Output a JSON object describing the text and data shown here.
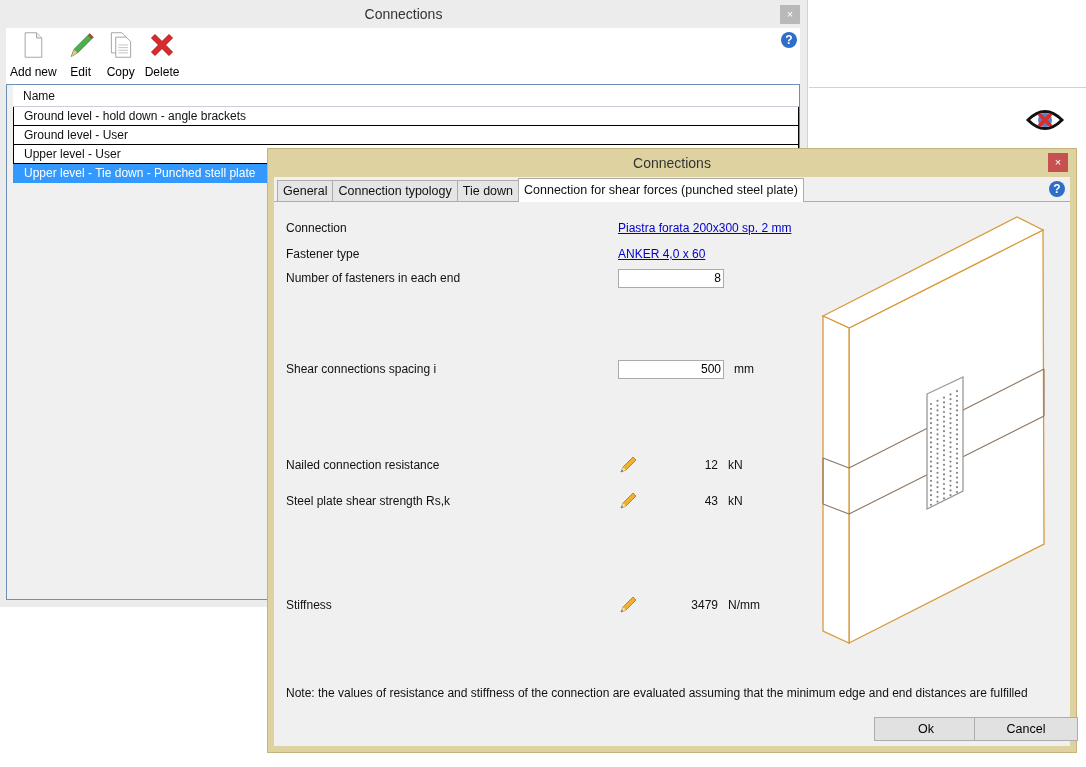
{
  "background_window": {
    "title": "Connections",
    "close_glyph": "×",
    "help_glyph": "?",
    "toolbar": [
      {
        "kind": "new",
        "label": "Add new"
      },
      {
        "kind": "edit",
        "label": "Edit"
      },
      {
        "kind": "copy",
        "label": "Copy"
      },
      {
        "kind": "delete",
        "label": "Delete"
      }
    ],
    "table": {
      "columns": [
        "Name"
      ],
      "rows": [
        {
          "name": "Ground level - hold down - angle brackets",
          "selected": false
        },
        {
          "name": "Ground level - User",
          "selected": false
        },
        {
          "name": "Upper level - User",
          "selected": false
        },
        {
          "name": "Upper level - Tie down - Punched stell plate",
          "selected": true
        }
      ]
    }
  },
  "dialog": {
    "title": "Connections",
    "close_glyph": "×",
    "help_glyph": "?",
    "tabs": [
      {
        "label": "General",
        "selected": false
      },
      {
        "label": "Connection typology",
        "selected": false
      },
      {
        "label": "Tie down",
        "selected": false
      },
      {
        "label": "Connection for shear forces (punched steel plate)",
        "selected": true
      }
    ],
    "fields": [
      {
        "kind": "link",
        "label": "Connection",
        "value": "Piastra forata 200x300 sp. 2 mm"
      },
      {
        "kind": "link",
        "label": "Fastener type",
        "value": "ANKER 4,0 x 60"
      },
      {
        "kind": "input",
        "label": "Number of fasteners in each end",
        "value": "8"
      },
      {
        "kind": "input",
        "label": "Shear connections spacing i",
        "value": "500",
        "unit": "mm"
      },
      {
        "kind": "computed",
        "label": "Nailed connection resistance",
        "value": "12",
        "unit": "kN"
      },
      {
        "kind": "computed",
        "label": "Steel plate shear strength Rs,k",
        "value": "43",
        "unit": "kN"
      },
      {
        "kind": "computed",
        "label": "Stiffness",
        "value": "3479",
        "unit": "N/mm"
      }
    ],
    "note": "Note: the values of resistance and stiffness of the connection are evaluated assuming that the minimum edge and end distances are fulfilled",
    "buttons": [
      "Ok",
      "Cancel"
    ]
  }
}
